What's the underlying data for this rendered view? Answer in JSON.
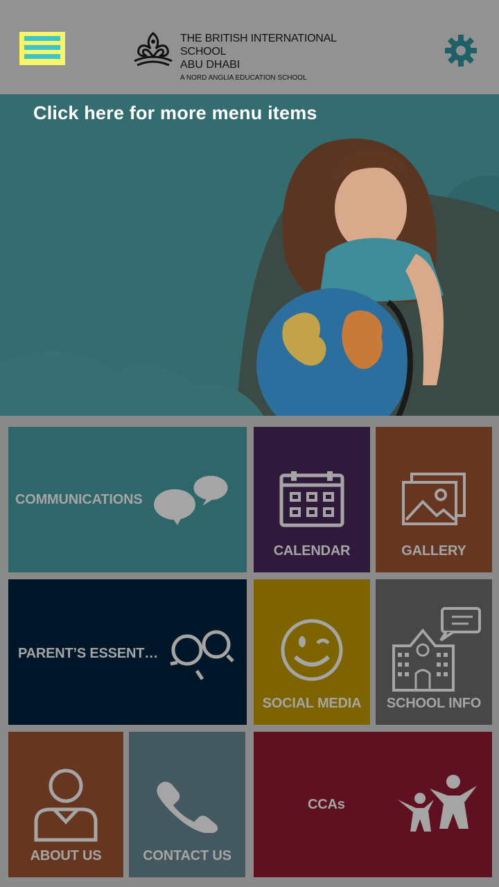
{
  "header": {
    "menu_icon": "hamburger-menu-icon",
    "settings_icon": "gear-icon",
    "logo": {
      "line1": "THE BRITISH INTERNATIONAL SCHOOL",
      "line2": "ABU DHABI",
      "line3": "A NORD ANGLIA EDUCATION SCHOOL"
    }
  },
  "hero": {
    "hint": "Click here for more menu items"
  },
  "tiles": [
    {
      "label": "COMMUNICATIONS",
      "color": "#2f6669",
      "icon": "chat-bubbles-icon"
    },
    {
      "label": "CALENDAR",
      "color": "#2f1a3c",
      "icon": "calendar-icon"
    },
    {
      "label": "GALLERY",
      "color": "#663620",
      "icon": "gallery-icon"
    },
    {
      "label": "PARENT’S ESSENT…",
      "color": "#00172a",
      "icon": "parents-icon"
    },
    {
      "label": "SOCIAL MEDIA",
      "color": "#7e6400",
      "icon": "smiley-wink-icon"
    },
    {
      "label": "SCHOOL INFO",
      "color": "#474747",
      "icon": "school-building-icon"
    },
    {
      "label": "ABOUT US",
      "color": "#663620",
      "icon": "person-icon"
    },
    {
      "label": "CONTACT US",
      "color": "#44585f",
      "icon": "phone-icon"
    },
    {
      "label": "CCAs",
      "color": "#5f1122",
      "icon": "people-cheering-icon"
    }
  ]
}
